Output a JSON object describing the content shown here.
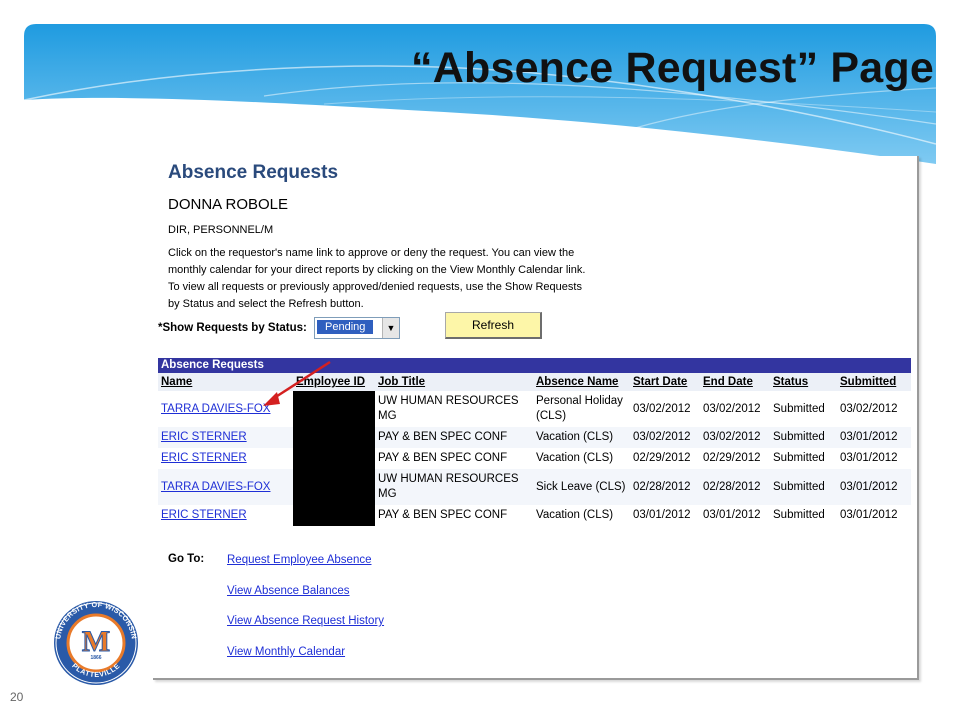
{
  "slide": {
    "title": "“Absence Request” Page",
    "page_number": "20"
  },
  "screen": {
    "title": "Absence Requests",
    "employee_name": "DONNA ROBOLE",
    "employee_title": "DIR, PERSONNEL/M",
    "instructions": [
      "Click on the requestor's name link to approve or deny the request. You can view the",
      "monthly calendar for your direct reports by clicking on the View Monthly Calendar link.",
      "To view all requests or previously approved/denied requests, use the Show Requests",
      "by Status and select the Refresh button."
    ],
    "status_filter": {
      "label": "*Show Requests by Status:",
      "selected": "Pending"
    },
    "refresh_label": "Refresh",
    "grid": {
      "header": "Absence Requests",
      "columns": [
        "Name",
        "Employee ID",
        "Job Title",
        "Absence Name",
        "Start Date",
        "End Date",
        "Status",
        "Submitted"
      ],
      "rows": [
        {
          "name": "TARRA DAVIES-FOX",
          "job": "UW HUMAN RESOURCES MG",
          "absence": "Personal Holiday (CLS)",
          "start": "03/02/2012",
          "end": "03/02/2012",
          "status": "Submitted",
          "submitted": "03/02/2012"
        },
        {
          "name": "ERIC STERNER",
          "job": "PAY & BEN SPEC CONF",
          "absence": "Vacation (CLS)",
          "start": "03/02/2012",
          "end": "03/02/2012",
          "status": "Submitted",
          "submitted": "03/01/2012"
        },
        {
          "name": "ERIC STERNER",
          "job": "PAY & BEN SPEC CONF",
          "absence": "Vacation (CLS)",
          "start": "02/29/2012",
          "end": "02/29/2012",
          "status": "Submitted",
          "submitted": "03/01/2012"
        },
        {
          "name": "TARRA DAVIES-FOX",
          "job": "UW HUMAN RESOURCES MG",
          "absence": "Sick Leave (CLS)",
          "start": "02/28/2012",
          "end": "02/28/2012",
          "status": "Submitted",
          "submitted": "03/01/2012"
        },
        {
          "name": "ERIC STERNER",
          "job": "PAY & BEN SPEC CONF",
          "absence": "Vacation (CLS)",
          "start": "03/01/2012",
          "end": "03/01/2012",
          "status": "Submitted",
          "submitted": "03/01/2012"
        }
      ]
    },
    "goto": {
      "label": "Go To:",
      "links": [
        "Request Employee Absence",
        "View Absence Balances",
        "View Absence Request History",
        "View Monthly Calendar"
      ]
    }
  },
  "logo": {
    "ring_text": "UNIVERSITY OF WISCONSIN",
    "bottom_text": "PLATTEVILLE",
    "year": "1866",
    "letter": "M"
  },
  "colors": {
    "banner_dark": "#1f9be0",
    "banner_light": "#bfe6fb",
    "screen_title": "#2a4a7c",
    "grid_header": "#3335a0",
    "link": "#1f2fd6",
    "refresh_button": "#fdf6a8",
    "arrow": "#d42020",
    "logo_blue": "#2a5aa8",
    "logo_orange": "#e87a2a"
  }
}
